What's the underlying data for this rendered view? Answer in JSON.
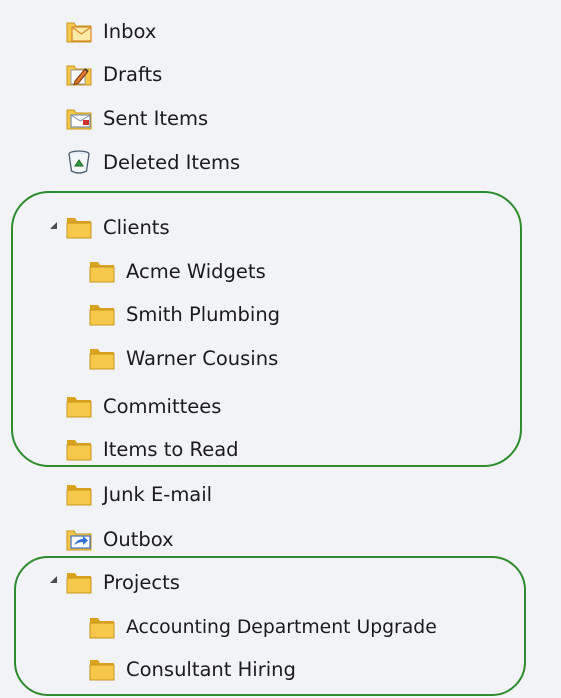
{
  "folders": [
    {
      "id": "inbox",
      "label": "Inbox",
      "icon": "inbox-icon"
    },
    {
      "id": "drafts",
      "label": "Drafts",
      "icon": "drafts-icon"
    },
    {
      "id": "sent-items",
      "label": "Sent Items",
      "icon": "sent-items-icon"
    },
    {
      "id": "deleted-items",
      "label": "Deleted Items",
      "icon": "deleted-items-icon"
    },
    {
      "id": "clients",
      "label": "Clients",
      "icon": "folder-icon",
      "expanded": true
    },
    {
      "id": "acme-widgets",
      "label": "Acme Widgets",
      "icon": "folder-icon"
    },
    {
      "id": "smith-plumbing",
      "label": "Smith Plumbing",
      "icon": "folder-icon"
    },
    {
      "id": "warner-cousins",
      "label": "Warner Cousins",
      "icon": "folder-icon"
    },
    {
      "id": "committees",
      "label": "Committees",
      "icon": "folder-icon"
    },
    {
      "id": "items-to-read",
      "label": "Items to Read",
      "icon": "folder-icon"
    },
    {
      "id": "junk-email",
      "label": "Junk E-mail",
      "icon": "folder-icon"
    },
    {
      "id": "outbox",
      "label": "Outbox",
      "icon": "outbox-icon"
    },
    {
      "id": "projects",
      "label": "Projects",
      "icon": "folder-icon",
      "expanded": true
    },
    {
      "id": "accounting-department-upgrade",
      "label": "Accounting Department Upgrade",
      "icon": "folder-icon"
    },
    {
      "id": "consultant-hiring",
      "label": "Consultant Hiring",
      "icon": "folder-icon"
    }
  ],
  "colors": {
    "background": "#f1f3f6",
    "text": "#1b1b1b",
    "folder_body": "#f5c84a",
    "folder_dark": "#d9a21f",
    "highlight_ring": "#2e8b2e"
  }
}
